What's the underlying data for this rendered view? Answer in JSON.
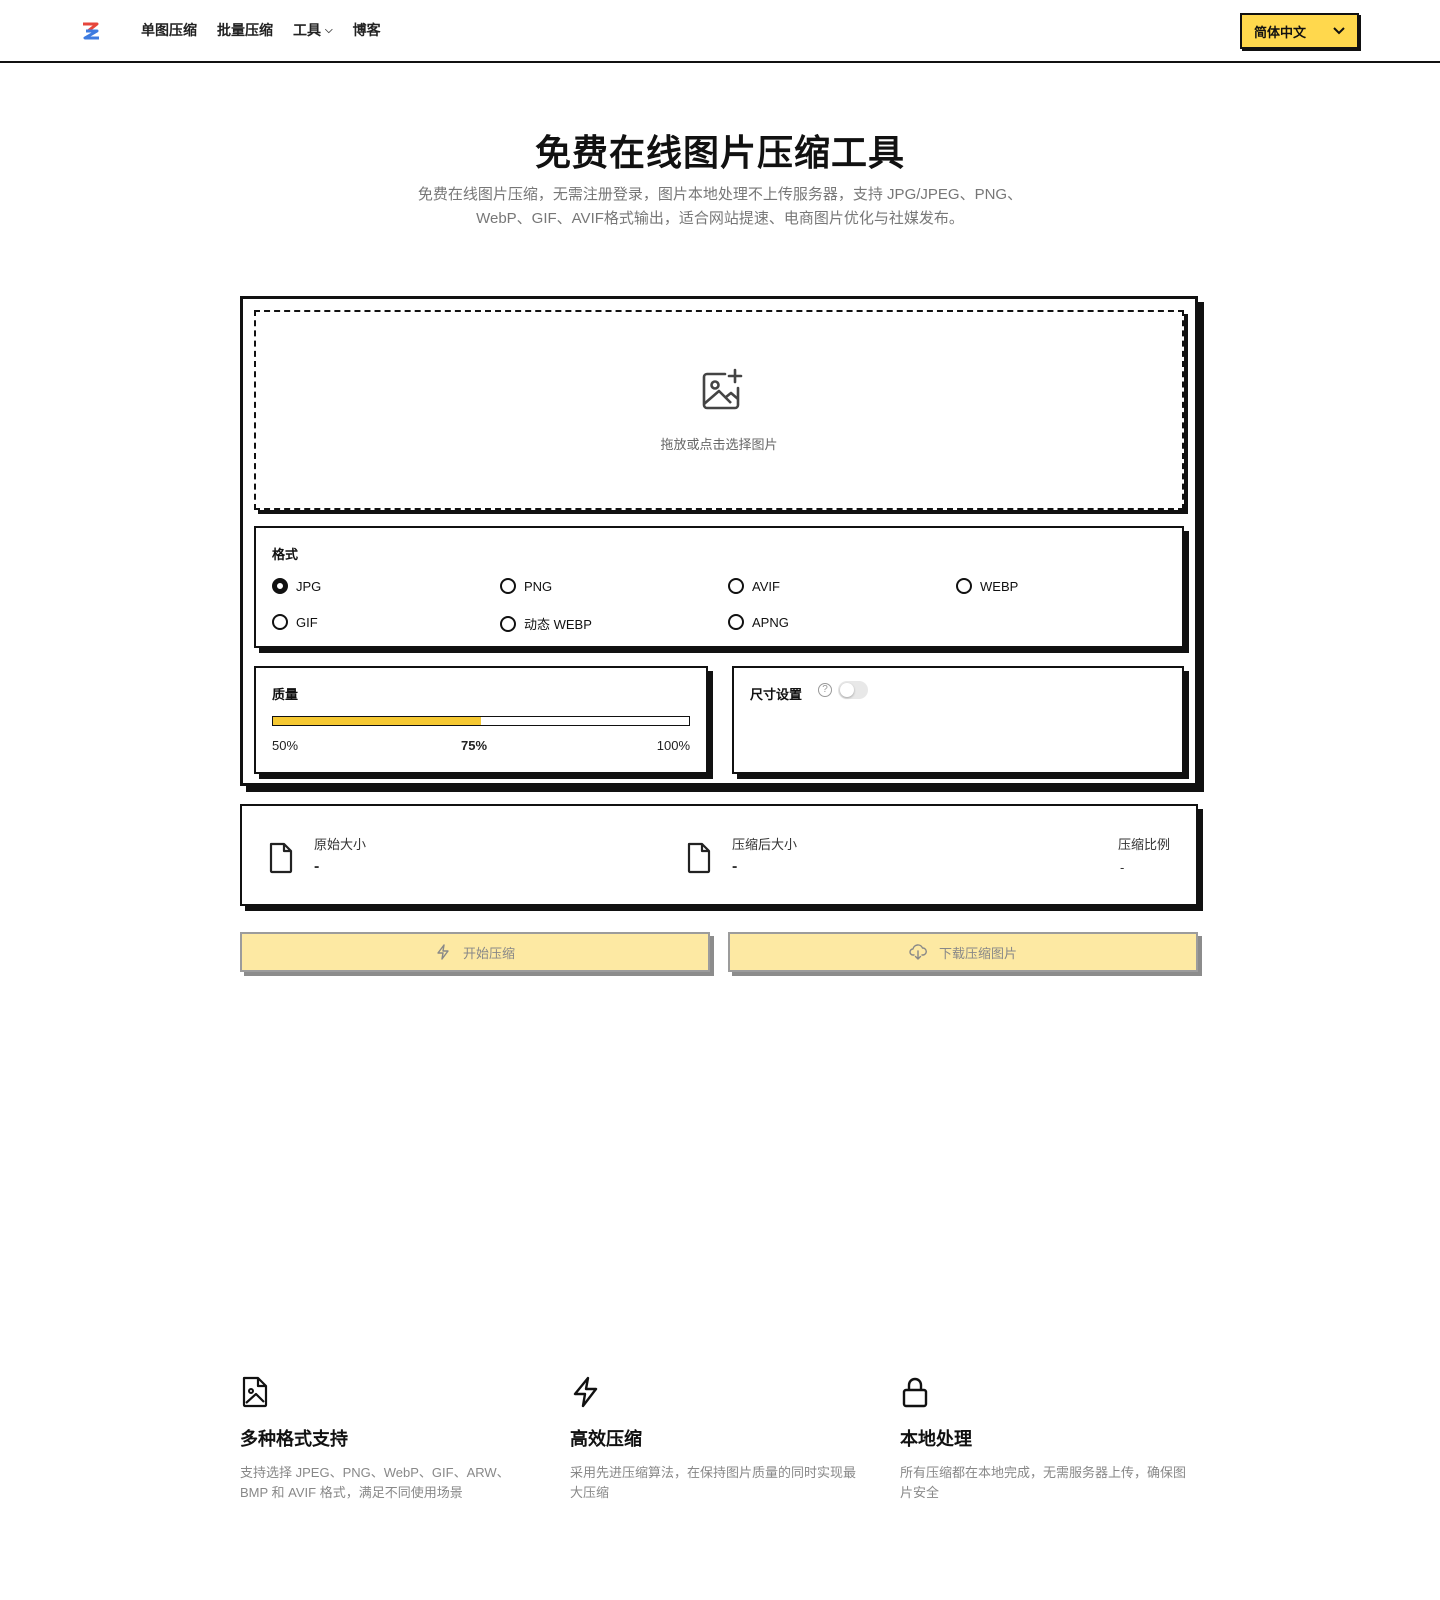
{
  "nav": {
    "items": [
      "单图压缩",
      "批量压缩",
      "工具",
      "博客"
    ],
    "language": "简体中文"
  },
  "hero": {
    "title": "免费在线图片压缩工具",
    "subtitle_line1": "免费在线图片压缩，无需注册登录，图片本地处理不上传服务器，支持 JPG/JPEG、PNG、",
    "subtitle_line2": "WebP、GIF、AVIF格式输出，适合网站提速、电商图片优化与社媒发布。"
  },
  "upload": {
    "hint": "拖放或点击选择图片"
  },
  "format": {
    "label": "格式",
    "options": [
      "JPG",
      "PNG",
      "AVIF",
      "WEBP",
      "GIF",
      "动态 WEBP",
      "APNG"
    ],
    "selected": "JPG"
  },
  "quality": {
    "label": "质量",
    "min_label": "50%",
    "current_label": "75%",
    "max_label": "100%",
    "value_fraction": 0.5
  },
  "size": {
    "label": "尺寸设置",
    "help": "?",
    "enabled": false
  },
  "stats": {
    "original_label": "原始大小",
    "original_value": "-",
    "compressed_label": "压缩后大小",
    "compressed_value": "-",
    "ratio_label": "压缩比例",
    "ratio_value": "-"
  },
  "actions": {
    "start": "开始压缩",
    "download": "下载压缩图片"
  },
  "features": [
    {
      "icon": "image-file-icon",
      "title": "多种格式支持",
      "desc": "支持选择 JPEG、PNG、WebP、GIF、ARW、BMP 和 AVIF 格式，满足不同使用场景"
    },
    {
      "icon": "lightning-icon",
      "title": "高效压缩",
      "desc": "采用先进压缩算法，在保持图片质量的同时实现最大压缩"
    },
    {
      "icon": "lock-icon",
      "title": "本地处理",
      "desc": "所有压缩都在本地完成，无需服务器上传，确保图片安全"
    }
  ],
  "colors": {
    "accent_yellow": "#ffd84d",
    "slider_fill": "#f5c832",
    "button_bg": "#fde9a3"
  }
}
